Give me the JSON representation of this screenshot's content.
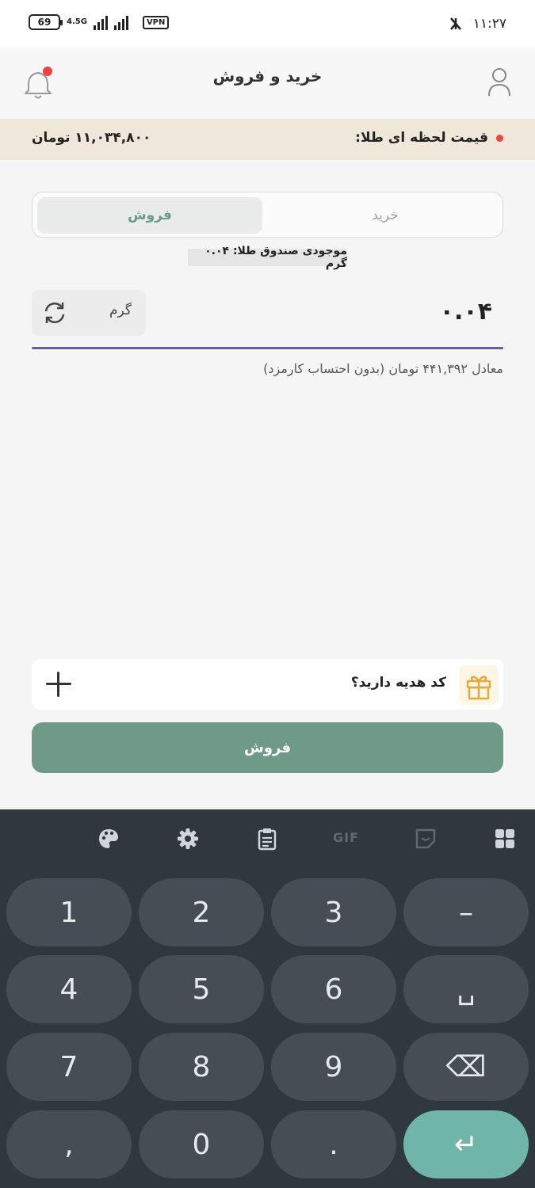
{
  "status_bar": {
    "battery": "69",
    "network": "4.5G",
    "vpn": "VPN",
    "time": "۱۱:۲۷"
  },
  "header": {
    "title": "خرید و فروش"
  },
  "price_bar": {
    "label": "قیمت لحظه ای طلا:",
    "value": "۱۱,۰۳۴,۸۰۰ تومان"
  },
  "tabs": {
    "buy": "خرید",
    "sell": "فروش",
    "active": "sell"
  },
  "balance": "موجودی صندوق طلا: ۰.۰۴ گرم",
  "amount_input": {
    "value": "۰.۰۴",
    "unit": "گرم"
  },
  "equivalent": "معادل ۴۴۱,۳۹۲ تومان (بدون احتساب کارمزد)",
  "gift": {
    "label": "کد هدیه دارید؟"
  },
  "submit_label": "فروش",
  "keyboard": {
    "toolbar": {
      "gif_label": "GIF"
    },
    "keys": [
      [
        "1",
        "2",
        "3",
        "–"
      ],
      [
        "4",
        "5",
        "6",
        "␣"
      ],
      [
        "7",
        "8",
        "9",
        "⌫"
      ],
      [
        ",",
        "0",
        ".",
        "↵"
      ]
    ]
  },
  "colors": {
    "accent": "#6e9a87",
    "price_bar_bg": "#efe7da",
    "input_underline": "#6b5a9c",
    "notification_dot": "#ef4444",
    "keyboard_bg": "#2e383d",
    "enter_key": "#6fb5aa"
  }
}
